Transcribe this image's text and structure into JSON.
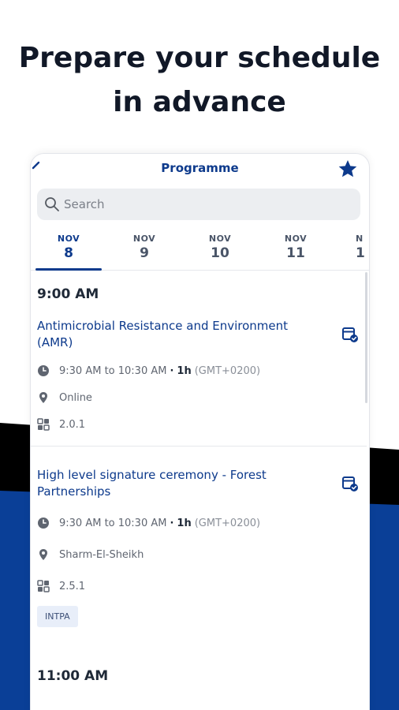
{
  "headline": {
    "line1": "Prepare your schedule",
    "line2": "in advance"
  },
  "colors": {
    "brand": "#0d3a8c",
    "accent_band": "#0a3f97"
  },
  "app": {
    "title": "Programme",
    "icons": {
      "back": "chevron-left-icon",
      "favorites": "star-icon",
      "search": "search-icon"
    },
    "search": {
      "placeholder": "Search",
      "value": ""
    },
    "dates": [
      {
        "month": "NOV",
        "day": "8",
        "active": true
      },
      {
        "month": "NOV",
        "day": "9",
        "active": false
      },
      {
        "month": "NOV",
        "day": "10",
        "active": false
      },
      {
        "month": "NOV",
        "day": "11",
        "active": false
      },
      {
        "month": "N",
        "day": "1",
        "active": false
      }
    ],
    "slots": [
      {
        "time": "9:00 AM",
        "sessions": [
          {
            "title": "Antimicrobial Resistance and Environment (AMR)",
            "time_range": "9:30 AM to 10:30 AM",
            "separator": "·",
            "duration": "1h",
            "timezone": "(GMT+0200)",
            "location": "Online",
            "room": "2.0.1",
            "tag": ""
          },
          {
            "title": "High level signature ceremony - Forest Partnerships",
            "time_range": "9:30 AM to 10:30 AM",
            "separator": "·",
            "duration": "1h",
            "timezone": "(GMT+0200)",
            "location": "Sharm-El-Sheikh",
            "room": "2.5.1",
            "tag": "INTPA"
          }
        ]
      },
      {
        "time": "11:00 AM",
        "sessions": []
      }
    ]
  }
}
